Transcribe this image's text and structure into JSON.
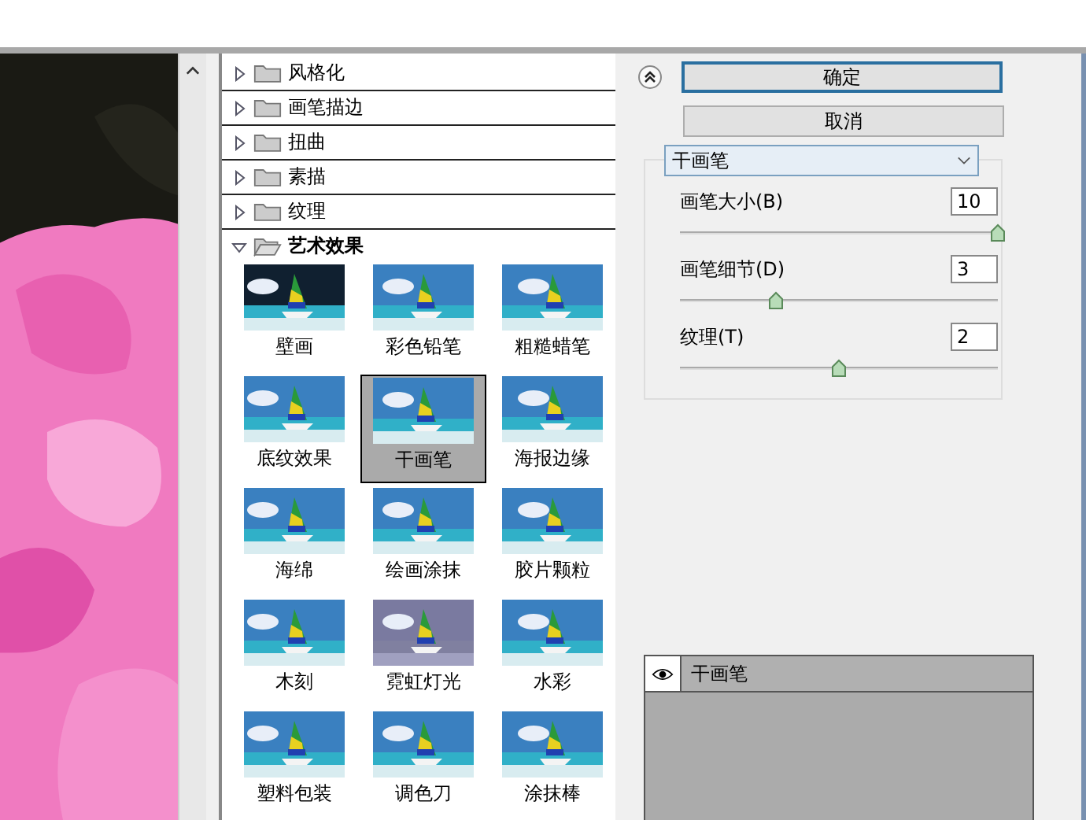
{
  "categories": [
    {
      "label": "风格化",
      "expanded": false
    },
    {
      "label": "画笔描边",
      "expanded": false
    },
    {
      "label": "扭曲",
      "expanded": false
    },
    {
      "label": "素描",
      "expanded": false
    },
    {
      "label": "纹理",
      "expanded": false
    },
    {
      "label": "艺术效果",
      "expanded": true
    }
  ],
  "filters": [
    {
      "label": "壁画",
      "selected": false
    },
    {
      "label": "彩色铅笔",
      "selected": false
    },
    {
      "label": "粗糙蜡笔",
      "selected": false
    },
    {
      "label": "底纹效果",
      "selected": false
    },
    {
      "label": "干画笔",
      "selected": true
    },
    {
      "label": "海报边缘",
      "selected": false
    },
    {
      "label": "海绵",
      "selected": false
    },
    {
      "label": "绘画涂抹",
      "selected": false
    },
    {
      "label": "胶片颗粒",
      "selected": false
    },
    {
      "label": "木刻",
      "selected": false
    },
    {
      "label": "霓虹灯光",
      "selected": false
    },
    {
      "label": "水彩",
      "selected": false
    },
    {
      "label": "塑料包装",
      "selected": false
    },
    {
      "label": "调色刀",
      "selected": false
    },
    {
      "label": "涂抹棒",
      "selected": false
    }
  ],
  "ok_button": "确定",
  "cancel_button": "取消",
  "filter_select": {
    "value": "干画笔"
  },
  "params": [
    {
      "label": "画笔大小(B)",
      "value": "10",
      "level": 1.0
    },
    {
      "label": "画笔细节(D)",
      "value": "3",
      "level": 0.3
    },
    {
      "label": "纹理(T)",
      "value": "2",
      "level": 0.5
    }
  ],
  "effect_layers": [
    {
      "label": "干画笔",
      "visible": true
    }
  ]
}
